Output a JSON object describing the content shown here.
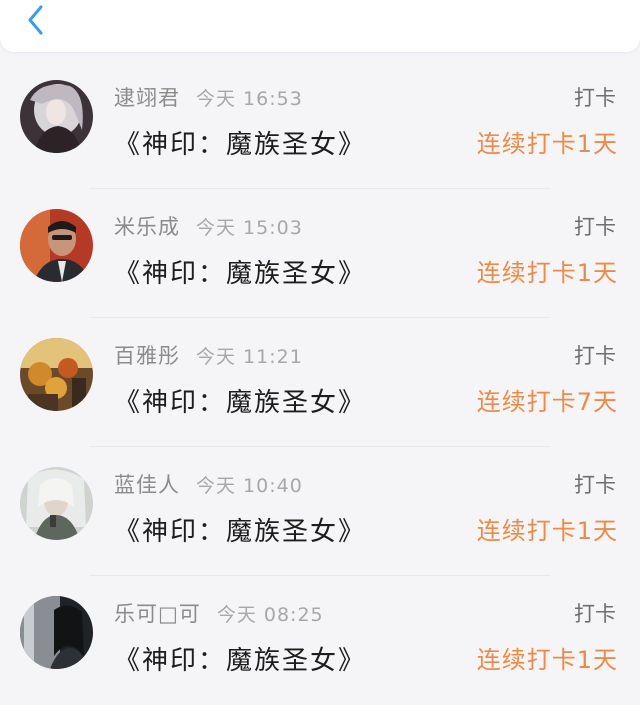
{
  "header": {
    "back_icon": "chevron-left-icon",
    "accent_color": "#3a9bf0"
  },
  "records": [
    {
      "user": "逮翊君",
      "time": "今天 16:53",
      "action": "打卡",
      "book": "《神印：魔族圣女》",
      "streak": "连续打卡1天"
    },
    {
      "user": "米乐成",
      "time": "今天 15:03",
      "action": "打卡",
      "book": "《神印：魔族圣女》",
      "streak": "连续打卡1天"
    },
    {
      "user": "百雅彤",
      "time": "今天 11:21",
      "action": "打卡",
      "book": "《神印：魔族圣女》",
      "streak": "连续打卡7天"
    },
    {
      "user": "蓝佳人",
      "time": "今天 10:40",
      "action": "打卡",
      "book": "《神印：魔族圣女》",
      "streak": "连续打卡1天"
    },
    {
      "user": "乐可□可",
      "time": "今天 08:25",
      "action": "打卡",
      "book": "《神印：魔族圣女》",
      "streak": "连续打卡1天"
    }
  ],
  "colors": {
    "streak": "#ec8a4a",
    "name": "#8b8b8b",
    "title": "#1d1d1d"
  }
}
